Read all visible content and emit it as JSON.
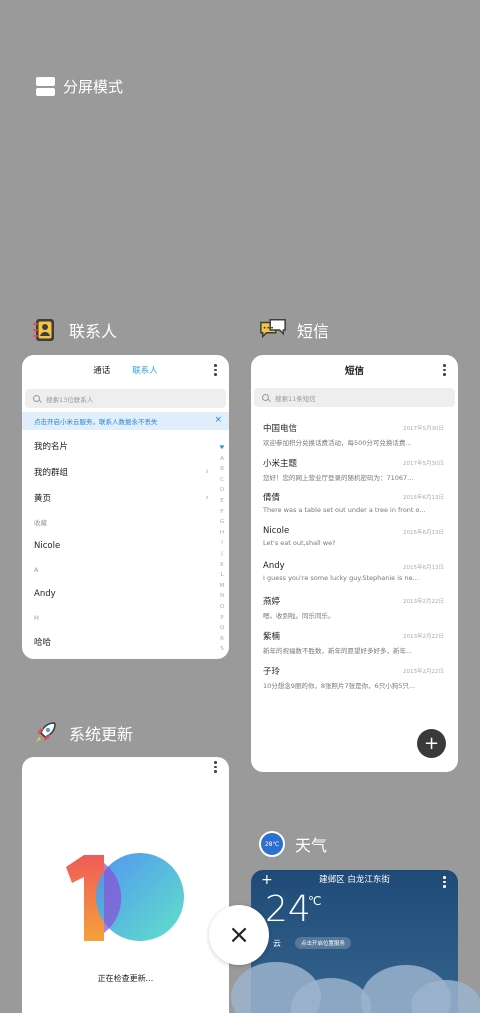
{
  "split_screen": {
    "label": "分屏模式"
  },
  "contacts": {
    "app_name": "联系人",
    "tabs": [
      "通话",
      "联系人"
    ],
    "search_placeholder": "搜索13位联系人",
    "banner": "点击开启小米云服务，联系人数据永不丢失",
    "banner_close": "×",
    "rows": [
      {
        "type": "item",
        "label": "我的名片",
        "chevron": false
      },
      {
        "type": "item",
        "label": "我的群组",
        "chevron": true
      },
      {
        "type": "item",
        "label": "黄页",
        "chevron": true
      },
      {
        "type": "section",
        "label": "收藏"
      },
      {
        "type": "item",
        "label": "Nicole",
        "chevron": false
      },
      {
        "type": "section",
        "label": "A"
      },
      {
        "type": "item",
        "label": "Andy",
        "chevron": false
      },
      {
        "type": "section",
        "label": "H"
      },
      {
        "type": "item",
        "label": "哈哈",
        "chevron": false
      }
    ],
    "index_letters": [
      "♥",
      "A",
      "B",
      "C",
      "D",
      "E",
      "F",
      "G",
      "H",
      "I",
      "J",
      "K",
      "L",
      "M",
      "N",
      "O",
      "P",
      "Q",
      "R",
      "S"
    ]
  },
  "sms": {
    "app_name": "短信",
    "title": "短信",
    "search_placeholder": "搜索11条短信",
    "messages": [
      {
        "name": "中国电信",
        "date": "2017年5月30日",
        "preview": "欢迎参加积分兑换话费活动，每500分可兑换话费..."
      },
      {
        "name": "小米主题",
        "date": "2017年5月30日",
        "preview": "您好！您的网上营业厅登录的随机密码为：71067..."
      },
      {
        "name": "倩倩",
        "date": "2015年6月13日",
        "preview": "There was a table set out under a tree in front o..."
      },
      {
        "name": "Nicole",
        "date": "2015年6月13日",
        "preview": "Let's eat out,shall we?"
      },
      {
        "name": "Andy",
        "date": "2015年6月13日",
        "preview": "I guess you're some lucky guy.Stephanie is ne..."
      },
      {
        "name": "燕婷",
        "date": "2013年2月22日",
        "preview": "嗯。收到啦。同乐同乐。"
      },
      {
        "name": "紫楠",
        "date": "2013年2月22日",
        "preview": "新年的祝福数不胜数，新年的愿望好多好多，新年..."
      },
      {
        "name": "子玲",
        "date": "2013年2月22日",
        "preview": "10分想念9丽的你，8张照片7张是你，6只小狗5只..."
      }
    ],
    "fab": "+"
  },
  "update": {
    "app_name": "系统更新",
    "status": "正在检查更新..."
  },
  "weather": {
    "app_name": "天气",
    "icon_text": "28℃",
    "location": "建邺区 白龙江东街",
    "temperature": "24",
    "unit": "℃",
    "condition": "云",
    "chip": "点击开启位置服务",
    "add": "+"
  },
  "close": {
    "label": "×"
  }
}
